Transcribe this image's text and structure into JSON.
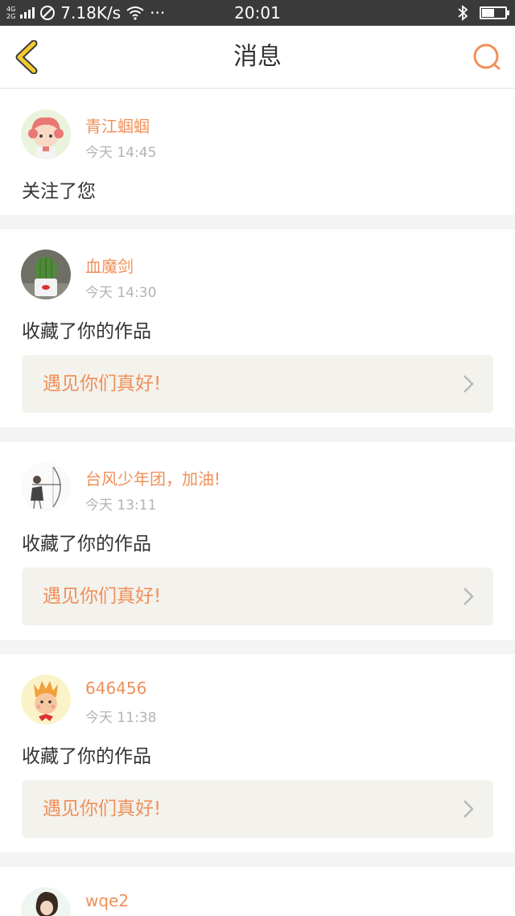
{
  "status_bar": {
    "network_type_top": "4G",
    "network_type_bottom": "2G",
    "speed": "7.18K/s",
    "more": "···",
    "time": "20:01",
    "battery_level": 0.55
  },
  "nav": {
    "title": "消息"
  },
  "messages": [
    {
      "username": "青江蝈蝈",
      "time": "今天 14:45",
      "action": "关注了您"
    },
    {
      "username": "血魔剑",
      "time": "今天 14:30",
      "action": "收藏了你的作品",
      "work_title": "遇见你们真好!"
    },
    {
      "username": "台风少年团，加油!",
      "time": "今天 13:11",
      "action": "收藏了你的作品",
      "work_title": "遇见你们真好!"
    },
    {
      "username": "646456",
      "time": "今天 11:38",
      "action": "收藏了你的作品",
      "work_title": "遇见你们真好!"
    },
    {
      "username": "wqe2"
    }
  ],
  "colors": {
    "accent": "#f0905a",
    "back_arrow": "#f2c92e",
    "work_bg": "#f3f2ec"
  },
  "icons": {
    "back": "back-arrow-icon",
    "search": "search-icon",
    "wifi": "wifi-icon",
    "bluetooth": "bluetooth-icon",
    "no_disturb": "do-not-disturb-icon",
    "battery": "battery-icon",
    "chevron": "chevron-right-icon"
  }
}
